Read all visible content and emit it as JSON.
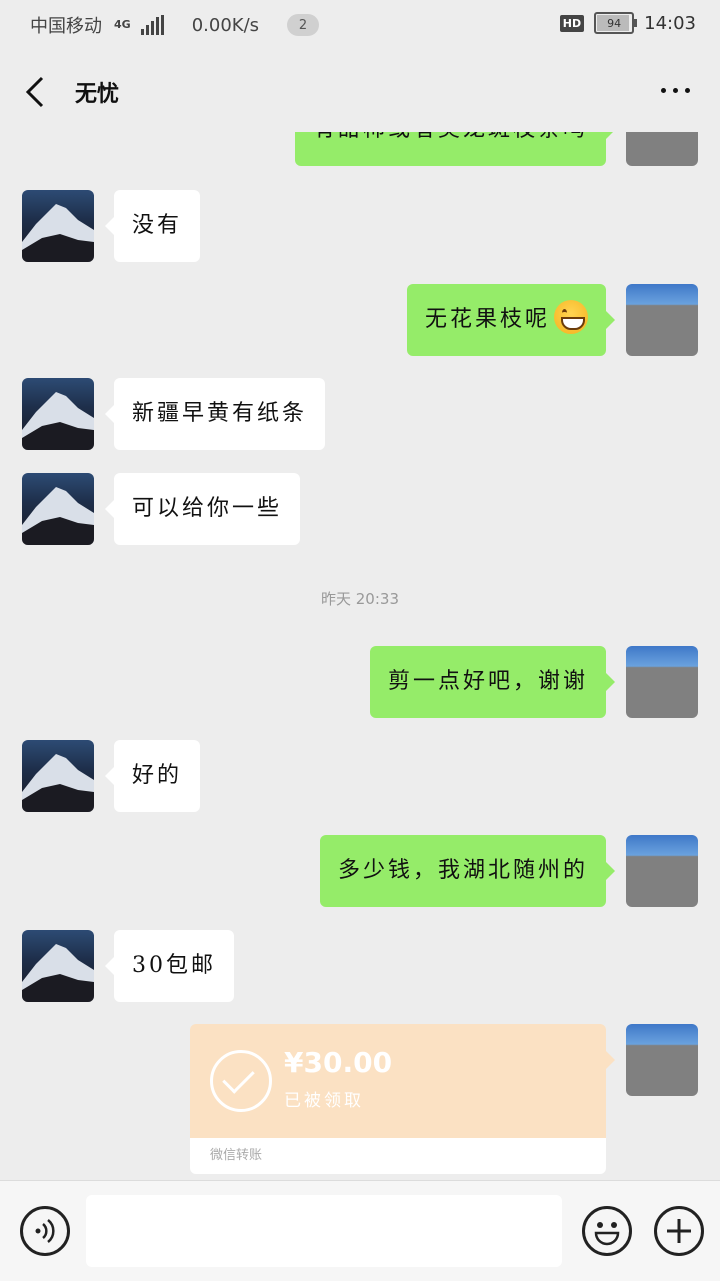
{
  "status_bar": {
    "carrier": "中国移动",
    "network": "4G",
    "speed": "0.00K/s",
    "badge": "2",
    "hd": "HD",
    "battery": "94",
    "time": "14:03"
  },
  "header": {
    "title": "无忧",
    "back_icon": "chevron-left-icon",
    "more_icon": "more-horizontal-icon"
  },
  "messages": [
    {
      "side": "out",
      "text": "有甜柿或者美龙斑枝条吗"
    },
    {
      "side": "in",
      "text": "没有"
    },
    {
      "side": "out",
      "text": "无花果枝呢",
      "emoji": "grin-emoji"
    },
    {
      "side": "in",
      "text": "新疆早黄有纸条"
    },
    {
      "side": "in",
      "text": "可以给你一些"
    },
    {
      "side": "out",
      "text": "剪一点好吧，谢谢"
    },
    {
      "side": "in",
      "text": "好的"
    },
    {
      "side": "out",
      "text": "多少钱，我湖北随州的"
    },
    {
      "side": "in",
      "text": "30包邮"
    }
  ],
  "timestamp": "昨天 20:33",
  "transfer": {
    "amount": "¥30.00",
    "status": "已被领取",
    "footer": "微信转账"
  },
  "input_bar": {
    "placeholder": "",
    "icons": [
      "voice-icon",
      "emoji-icon",
      "plus-icon"
    ]
  }
}
